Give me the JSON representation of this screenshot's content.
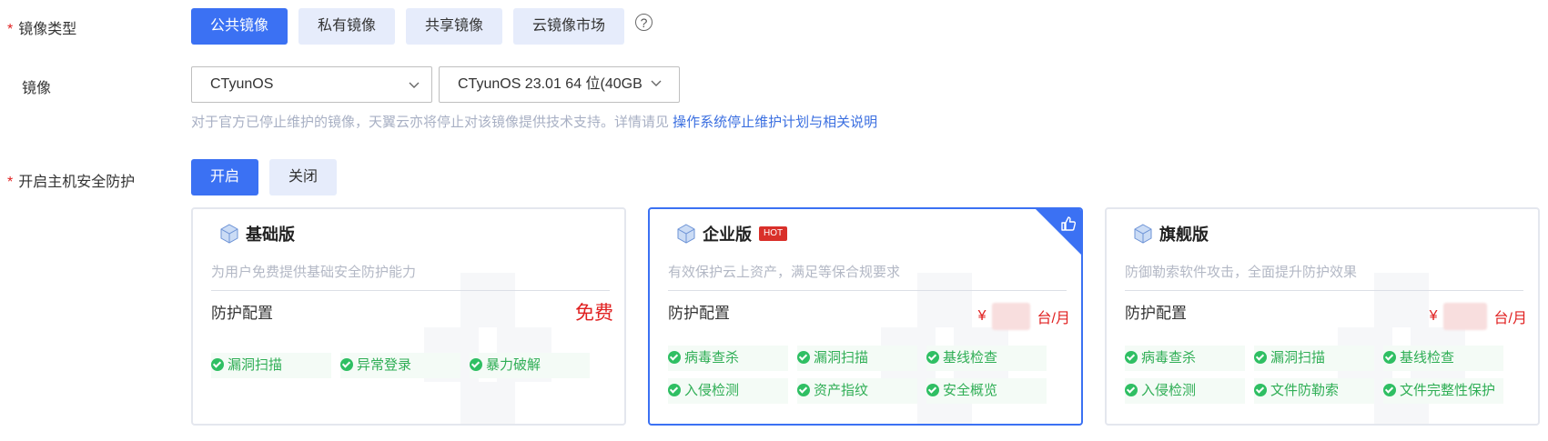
{
  "image_type": {
    "label": "镜像类型",
    "required_mark": "*",
    "tabs": [
      {
        "label": "公共镜像",
        "active": true
      },
      {
        "label": "私有镜像",
        "active": false
      },
      {
        "label": "共享镜像",
        "active": false
      },
      {
        "label": "云镜像市场",
        "active": false
      }
    ],
    "help": "?"
  },
  "image": {
    "label": "镜像",
    "os_value": "CTyunOS",
    "version_value": "CTyunOS 23.01 64 位(40GB",
    "hint_text": "对于官方已停止维护的镜像，天翼云亦将停止对该镜像提供技术支持。详情请见 ",
    "hint_link": "操作系统停止维护计划与相关说明"
  },
  "security": {
    "label": "开启主机安全防护",
    "required_mark": "*",
    "options": [
      {
        "label": "开启",
        "active": true
      },
      {
        "label": "关闭",
        "active": false
      }
    ]
  },
  "plans": [
    {
      "title": "基础版",
      "desc": "为用户免费提供基础安全防护能力",
      "cfg_label": "防护配置",
      "price_text": "免费",
      "features": [
        "漏洞扫描",
        "异常登录",
        "暴力破解"
      ]
    },
    {
      "title": "企业版",
      "badge": "HOT",
      "desc": "有效保护云上资产，满足等保合规要求",
      "cfg_label": "防护配置",
      "currency": "¥",
      "unit": "台/月",
      "selected": true,
      "features": [
        "病毒查杀",
        "漏洞扫描",
        "基线检查",
        "入侵检测",
        "资产指纹",
        "安全概览"
      ]
    },
    {
      "title": "旗舰版",
      "desc": "防御勒索软件攻击，全面提升防护效果",
      "cfg_label": "防护配置",
      "currency": "¥",
      "unit": "台/月",
      "features": [
        "病毒查杀",
        "漏洞扫描",
        "基线检查",
        "入侵检测",
        "文件防勒索",
        "文件完整性保护"
      ]
    }
  ],
  "colors": {
    "primary": "#3b71f3",
    "tab_bg": "#e6ecfb",
    "price_red": "#e02020",
    "feature_green": "#2fae55"
  }
}
